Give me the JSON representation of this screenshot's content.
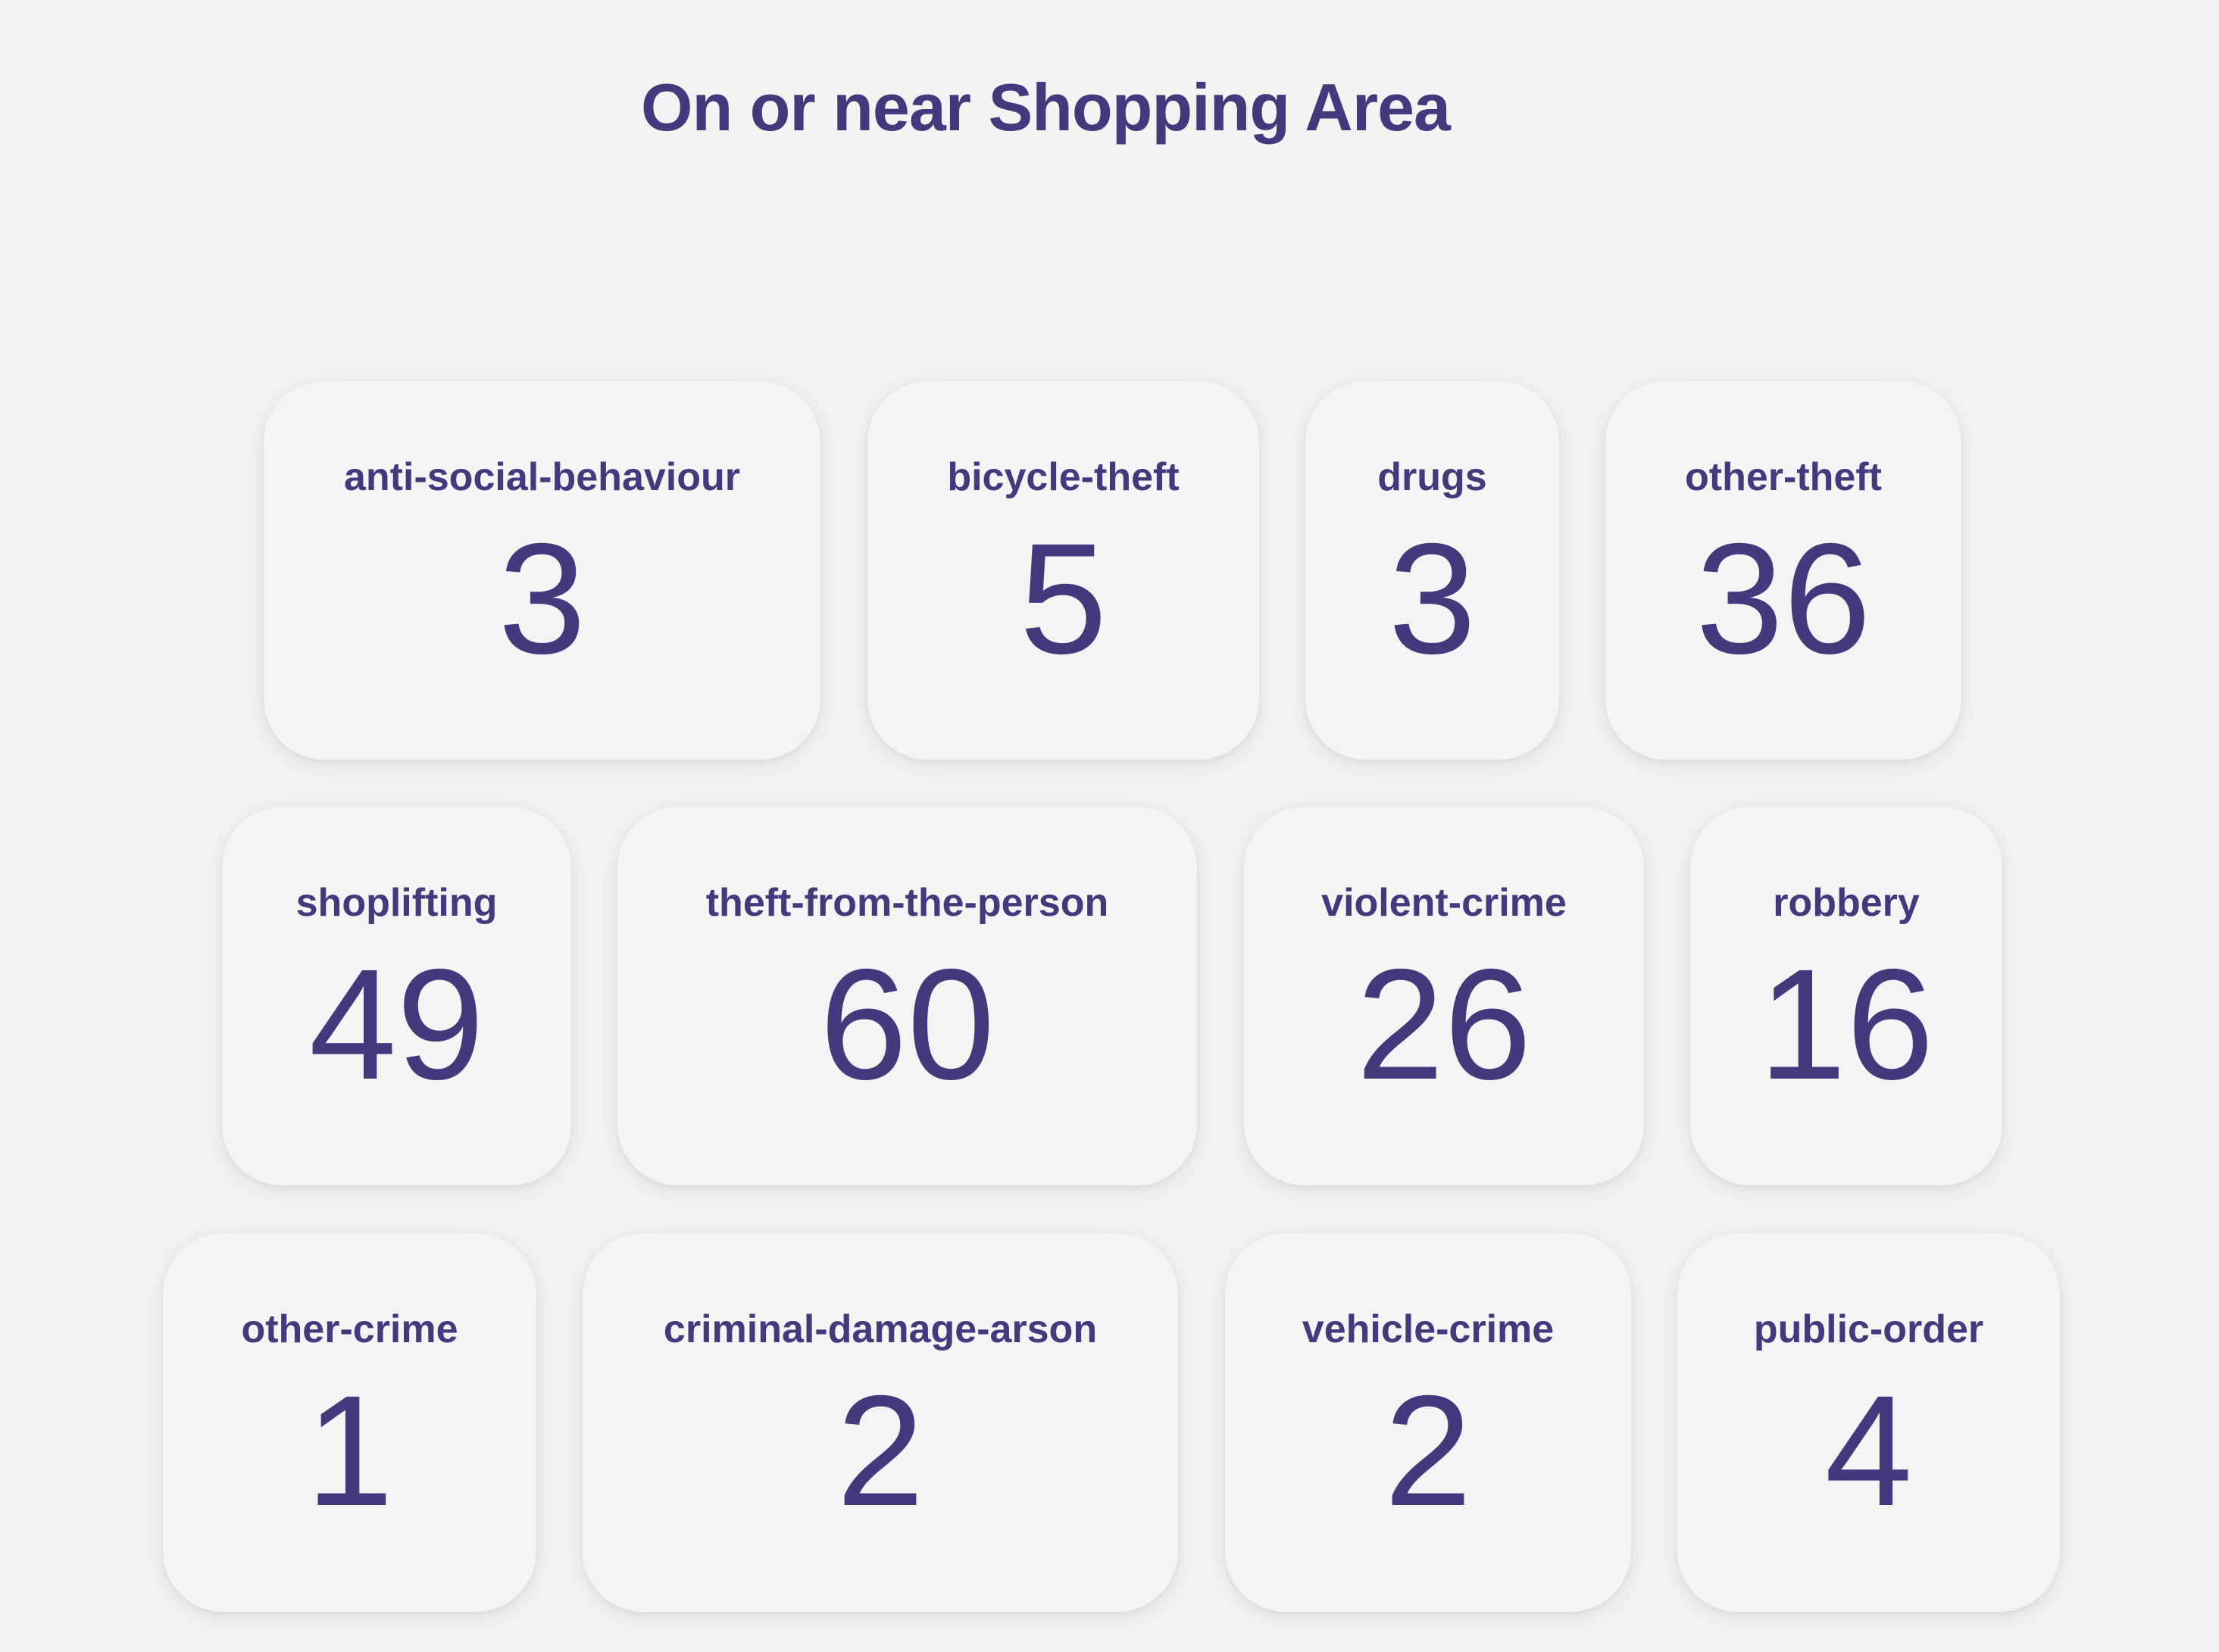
{
  "page": {
    "title": "On or near Shopping Area"
  },
  "colors": {
    "background": "#f4f2f3",
    "card": "#f5f3f4",
    "text": "#433a7d"
  },
  "categories": [
    {
      "label": "anti-social-behaviour",
      "value": "3"
    },
    {
      "label": "bicycle-theft",
      "value": "5"
    },
    {
      "label": "drugs",
      "value": "3"
    },
    {
      "label": "other-theft",
      "value": "36"
    },
    {
      "label": "shoplifting",
      "value": "49"
    },
    {
      "label": "theft-from-the-person",
      "value": "60"
    },
    {
      "label": "violent-crime",
      "value": "26"
    },
    {
      "label": "robbery",
      "value": "16"
    },
    {
      "label": "other-crime",
      "value": "1"
    },
    {
      "label": "criminal-damage-arson",
      "value": "2"
    },
    {
      "label": "vehicle-crime",
      "value": "2"
    },
    {
      "label": "public-order",
      "value": "4"
    }
  ]
}
